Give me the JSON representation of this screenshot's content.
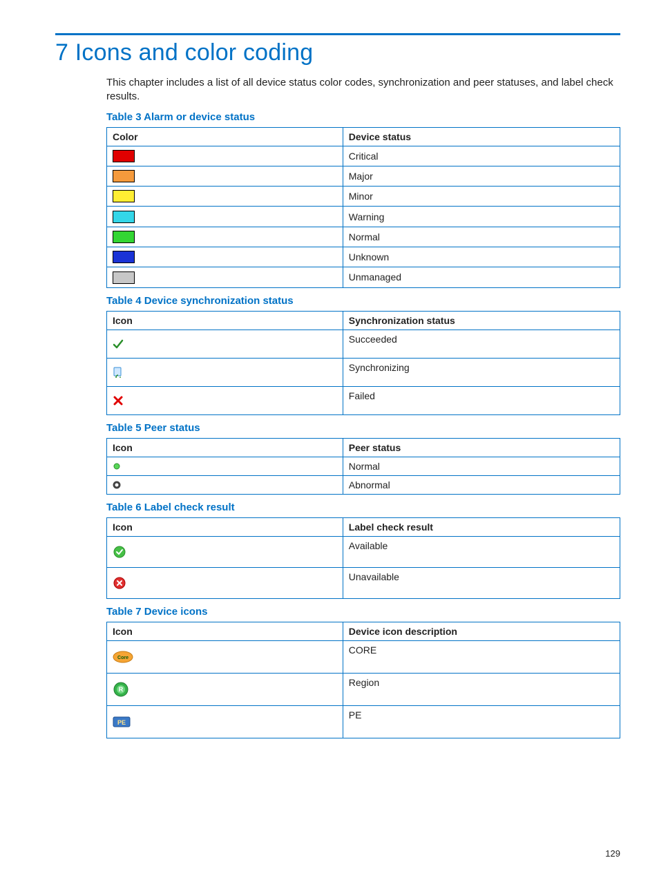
{
  "heading": "7 Icons and color coding",
  "intro": "This chapter includes a list of all device status color codes, synchronization and peer statuses, and label check results.",
  "pageNumber": "129",
  "tables": {
    "t3": {
      "caption": "Table 3 Alarm or device status",
      "h1": "Color",
      "h2": "Device status",
      "rows": [
        {
          "color": "#e00000",
          "status": "Critical"
        },
        {
          "color": "#f59a3c",
          "status": "Major"
        },
        {
          "color": "#ffee33",
          "status": "Minor"
        },
        {
          "color": "#33d6e8",
          "status": "Warning"
        },
        {
          "color": "#33d633",
          "status": "Normal"
        },
        {
          "color": "#1a33d6",
          "status": "Unknown"
        },
        {
          "color": "#c7c7c7",
          "status": "Unmanaged"
        }
      ]
    },
    "t4": {
      "caption": "Table 4 Device synchronization status",
      "h1": "Icon",
      "h2": "Synchronization status",
      "rows": [
        {
          "icon": "check-green",
          "status": "Succeeded"
        },
        {
          "icon": "sync-doc",
          "status": "Synchronizing"
        },
        {
          "icon": "x-red",
          "status": "Failed"
        }
      ]
    },
    "t5": {
      "caption": "Table 5 Peer status",
      "h1": "Icon",
      "h2": "Peer status",
      "rows": [
        {
          "icon": "dot-green",
          "status": "Normal"
        },
        {
          "icon": "ring-dark",
          "status": "Abnormal"
        }
      ]
    },
    "t6": {
      "caption": "Table 6 Label check result",
      "h1": "Icon",
      "h2": "Label check result",
      "rows": [
        {
          "icon": "badge-check-green",
          "status": "Available"
        },
        {
          "icon": "badge-x-red",
          "status": "Unavailable"
        }
      ]
    },
    "t7": {
      "caption": "Table 7 Device icons",
      "h1": "Icon",
      "h2": "Device icon description",
      "rows": [
        {
          "icon": "core-icon",
          "status": "CORE"
        },
        {
          "icon": "region-icon",
          "status": "Region"
        },
        {
          "icon": "pe-icon",
          "status": "PE"
        }
      ]
    }
  }
}
